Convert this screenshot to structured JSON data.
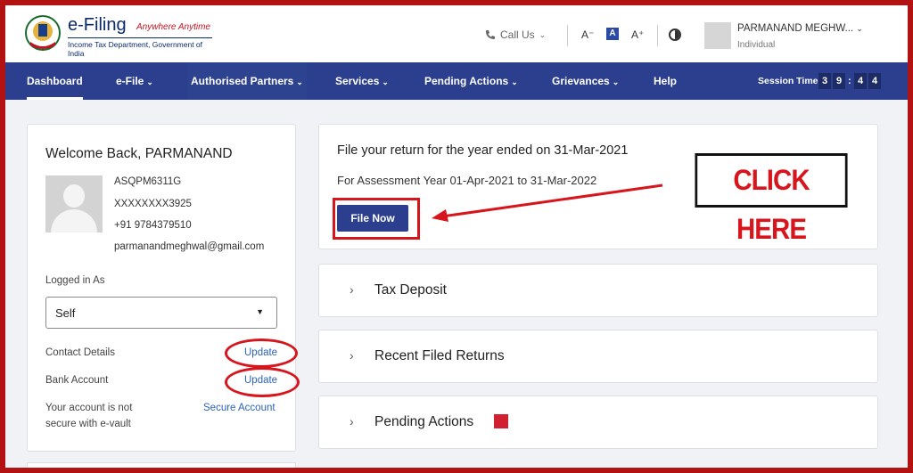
{
  "header": {
    "logo_title": "e-Filing",
    "logo_tagline": "Anywhere Anytime",
    "logo_subtitle": "Income Tax Department, Government of India",
    "call_us": "Call Us",
    "font_decrease": "A⁻",
    "font_default": "A",
    "font_increase": "A⁺",
    "user_name": "PARMANAND MEGHW...",
    "user_role": "Individual"
  },
  "nav": {
    "items": [
      {
        "label": "Dashboard"
      },
      {
        "label": "e-File"
      },
      {
        "label": "Authorised Partners"
      },
      {
        "label": "Services"
      },
      {
        "label": "Pending Actions"
      },
      {
        "label": "Grievances"
      },
      {
        "label": "Help"
      }
    ],
    "session_label": "Session Time",
    "session_digits": [
      "3",
      "9",
      "4",
      "4"
    ]
  },
  "profile": {
    "welcome": "Welcome Back, PARMANAND",
    "pan": "ASQPM6311G",
    "aadhaar": "XXXXXXXX3925",
    "phone": "+91 9784379510",
    "email": "parmanandmeghwal@gmail.com",
    "logged_in_label": "Logged in As",
    "logged_in_value": "Self",
    "contact_label": "Contact Details",
    "contact_link": "Update",
    "bank_label": "Bank Account",
    "bank_link": "Update",
    "secure_text_line1": "Your account is not",
    "secure_text_line2": "secure with e-vault",
    "secure_link": "Secure Account"
  },
  "return": {
    "title": "File your return for the year ended on 31-Mar-2021",
    "subtitle": "For Assessment Year 01-Apr-2021 to 31-Mar-2022",
    "button": "File Now",
    "annotation": "CLICK HERE"
  },
  "sections": [
    {
      "label": "Tax Deposit"
    },
    {
      "label": "Recent Filed Returns"
    },
    {
      "label": "Pending Actions"
    }
  ],
  "colors": {
    "nav_bg": "#2b3f8e",
    "accent_red": "#d6151d",
    "link_blue": "#2b63b8"
  }
}
